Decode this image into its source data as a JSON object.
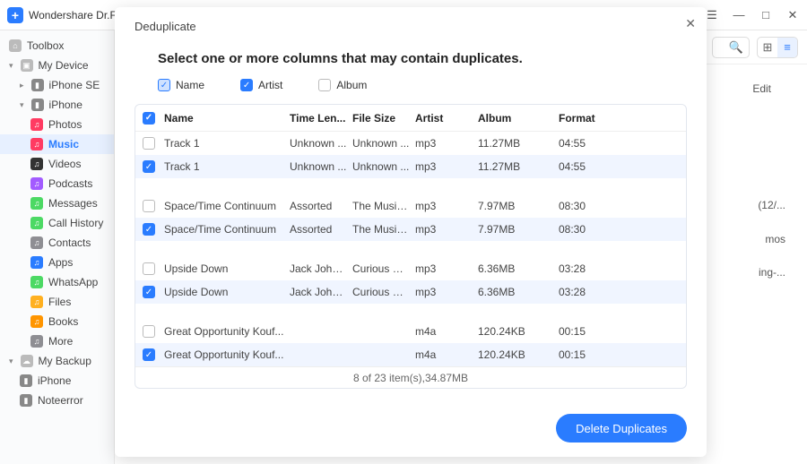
{
  "app": {
    "title": "Wondershare Dr.Fon..."
  },
  "window_buttons": {
    "history": "history-icon",
    "list": "list-icon",
    "min": "—",
    "max": "□",
    "close": "✕"
  },
  "toolbar": {
    "search_placeholder": "",
    "grid_icon": "⊞",
    "list_icon": "≡"
  },
  "sidebar": {
    "toolbox": "Toolbox",
    "my_device": "My Device",
    "devices": [
      {
        "label": "iPhone SE"
      },
      {
        "label": "iPhone",
        "children": [
          {
            "label": "Photos",
            "color": "#ff3b62"
          },
          {
            "label": "Music",
            "color": "#ff3b62",
            "active": true
          },
          {
            "label": "Videos",
            "color": "#333"
          },
          {
            "label": "Podcasts",
            "color": "#a25bff"
          },
          {
            "label": "Messages",
            "color": "#4cd964"
          },
          {
            "label": "Call History",
            "color": "#4cd964"
          },
          {
            "label": "Contacts",
            "color": "#8e8e93"
          },
          {
            "label": "Apps",
            "color": "#2a7cff"
          },
          {
            "label": "WhatsApp",
            "color": "#4cd964"
          },
          {
            "label": "Files",
            "color": "#ffb020"
          },
          {
            "label": "Books",
            "color": "#ff9500"
          },
          {
            "label": "More",
            "color": "#8e8e93"
          }
        ]
      }
    ],
    "backup": "My Backup",
    "backup_items": [
      {
        "label": "iPhone"
      },
      {
        "label": "Noteerror"
      }
    ]
  },
  "right_hints": {
    "edit": "Edit",
    "t1": "(12/...",
    "t2": "mos",
    "t3": "ing-..."
  },
  "modal": {
    "title": "Deduplicate",
    "subtitle": "Select one or more columns that may contain duplicates.",
    "column_filters": [
      {
        "label": "Name",
        "checked": "half"
      },
      {
        "label": "Artist",
        "checked": true
      },
      {
        "label": "Album",
        "checked": false
      }
    ],
    "headers": [
      "Name",
      "Time Len...",
      "File Size",
      "Artist",
      "Album",
      "Format"
    ],
    "groups": [
      [
        {
          "sel": false,
          "name": "Track 1",
          "time": "Unknown ...",
          "size": "Unknown ...",
          "artist": "mp3",
          "album": "11.27MB",
          "format": "04:55"
        },
        {
          "sel": true,
          "name": "Track 1",
          "time": "Unknown ...",
          "size": "Unknown ...",
          "artist": "mp3",
          "album": "11.27MB",
          "format": "04:55"
        }
      ],
      [
        {
          "sel": false,
          "name": "Space/Time Continuum",
          "time": "Assorted",
          "size": "The Music...",
          "artist": "mp3",
          "album": "7.97MB",
          "format": "08:30"
        },
        {
          "sel": true,
          "name": "Space/Time Continuum",
          "time": "Assorted",
          "size": "The Music...",
          "artist": "mp3",
          "album": "7.97MB",
          "format": "08:30"
        }
      ],
      [
        {
          "sel": false,
          "name": "Upside Down",
          "time": "Jack John...",
          "size": "Curious G...",
          "artist": "mp3",
          "album": "6.36MB",
          "format": "03:28"
        },
        {
          "sel": true,
          "name": "Upside Down",
          "time": "Jack John...",
          "size": "Curious G...",
          "artist": "mp3",
          "album": "6.36MB",
          "format": "03:28"
        }
      ],
      [
        {
          "sel": false,
          "name": "Great Opportunity Kouf...",
          "time": "",
          "size": "",
          "artist": "m4a",
          "album": "120.24KB",
          "format": "00:15"
        },
        {
          "sel": true,
          "name": "Great Opportunity Kouf...",
          "time": "",
          "size": "",
          "artist": "m4a",
          "album": "120.24KB",
          "format": "00:15"
        }
      ]
    ],
    "footer_text": "8 of 23 item(s),34.87MB",
    "delete_label": "Delete Duplicates"
  }
}
